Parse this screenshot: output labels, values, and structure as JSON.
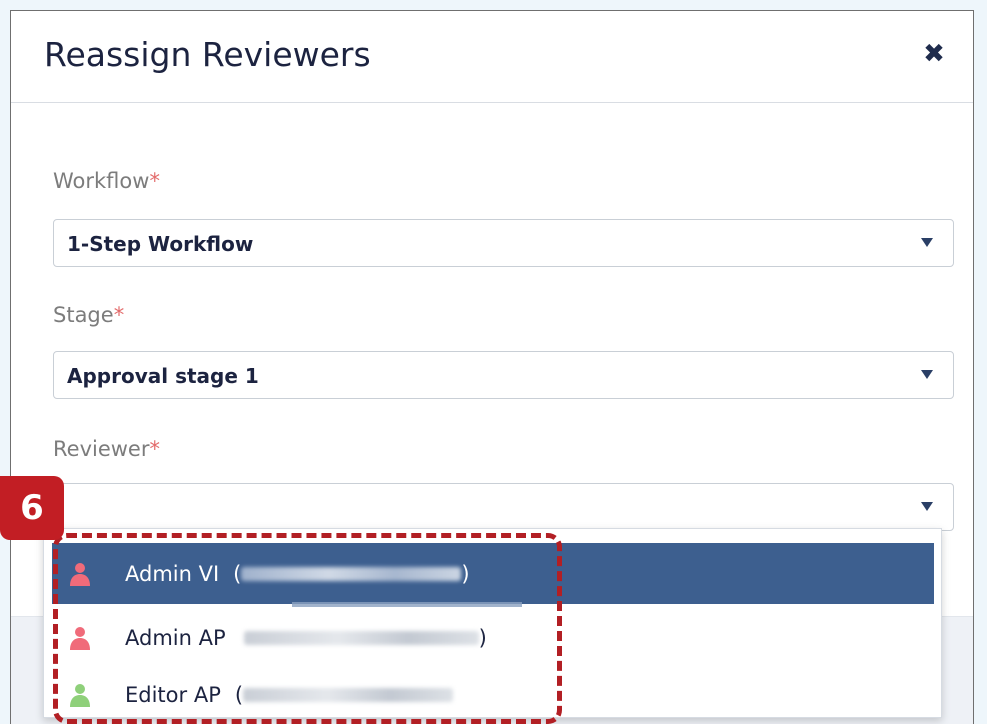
{
  "modal": {
    "title": "Reassign Reviewers",
    "close_icon": "close-icon"
  },
  "fields": {
    "workflow": {
      "label": "Workflow",
      "required_mark": "*",
      "value": "1-Step Workflow"
    },
    "stage": {
      "label": "Stage",
      "required_mark": "*",
      "value": "Approval stage 1"
    },
    "reviewer": {
      "label": "Reviewer",
      "required_mark": "*",
      "value": ""
    }
  },
  "reviewer_options": [
    {
      "name": "Admin VI",
      "prefix": "(",
      "suffix": ")",
      "icon": "person-icon",
      "icon_color": "#f06b7a",
      "selected": true
    },
    {
      "name": "Admin AP",
      "prefix": "",
      "suffix": ")",
      "icon": "person-icon",
      "icon_color": "#f06b7a",
      "selected": false
    },
    {
      "name": "Editor AP",
      "prefix": "(",
      "suffix": "",
      "icon": "person-icon",
      "icon_color": "#8fd07a",
      "selected": false
    }
  ],
  "annotation": {
    "step_number": "6",
    "color": "#c21e24"
  },
  "colors": {
    "selected_option_bg": "#3d5f8f",
    "title_color": "#1c2340",
    "required_color": "#e36b6b"
  }
}
